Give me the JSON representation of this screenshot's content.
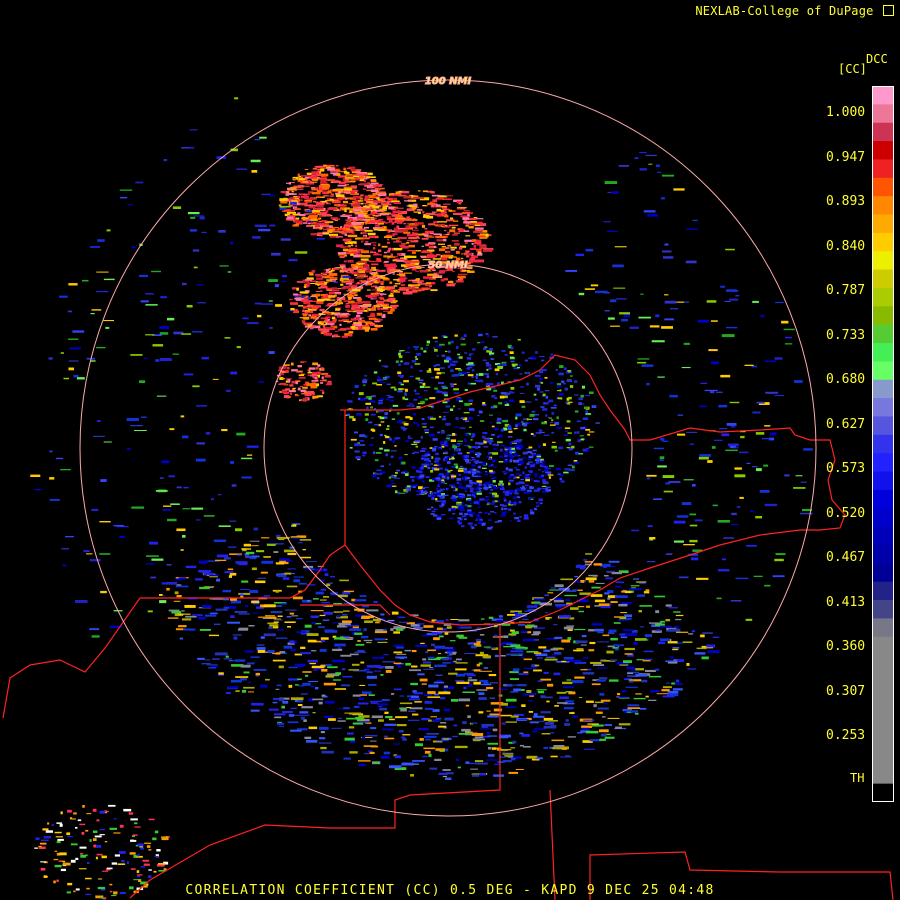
{
  "credit": "NEXLAB-College of DuPage",
  "product": {
    "footer": "CORRELATION COEFFICIENT (CC) 0.5 DEG - KAPD 9 DEC 25 04:48"
  },
  "range_rings": [
    {
      "label": "100 NMI",
      "nmi": 100
    },
    {
      "label": "50 NMI",
      "nmi": 50
    }
  ],
  "colorbar": {
    "title": "DCC",
    "unit": "[CC]",
    "labels": [
      "1.000",
      "0.947",
      "0.893",
      "0.840",
      "0.787",
      "0.733",
      "0.680",
      "0.627",
      "0.573",
      "0.520",
      "0.467",
      "0.413",
      "0.360",
      "0.307",
      "0.253"
    ],
    "threshold_label": "TH",
    "colors": [
      "#ff99cc",
      "#ee7799",
      "#cc3355",
      "#cc0000",
      "#ee2222",
      "#ff5500",
      "#ff8800",
      "#ffaa00",
      "#ffcc00",
      "#eeee00",
      "#cccc00",
      "#aacc00",
      "#88bb00",
      "#55cc33",
      "#44ee55",
      "#66ff66",
      "#8899cc",
      "#7777dd",
      "#5555dd",
      "#3333ee",
      "#2222ff",
      "#1111ee",
      "#0000dd",
      "#0000cc",
      "#0000bb",
      "#0000aa",
      "#000099",
      "#222288",
      "#444488",
      "#777788",
      "#888888",
      "#888888",
      "#888888",
      "#888888",
      "#888888",
      "#888888",
      "#888888",
      "#888888",
      "#000000"
    ]
  },
  "colors": {
    "ring": "#ffaaaa",
    "border": "#ff2222",
    "text": "#ffff33"
  }
}
